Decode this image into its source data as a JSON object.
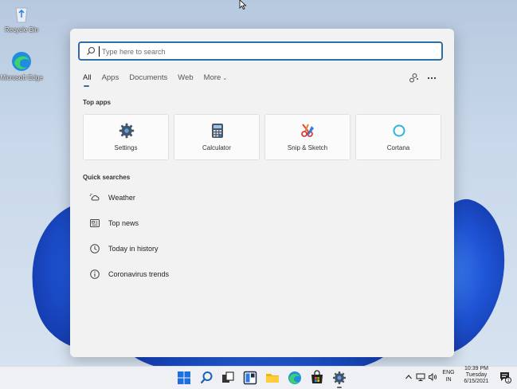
{
  "desktop": {
    "icons": [
      {
        "label": "Recycle Bin"
      },
      {
        "label": "Microsoft Edge"
      }
    ]
  },
  "search": {
    "placeholder": "Type here to search",
    "value": ""
  },
  "tabs": [
    {
      "label": "All",
      "active": true
    },
    {
      "label": "Apps"
    },
    {
      "label": "Documents"
    },
    {
      "label": "Web"
    },
    {
      "label": "More",
      "icon": "chevron-down-icon"
    }
  ],
  "top_apps": {
    "title": "Top apps",
    "items": [
      {
        "label": "Settings",
        "icon": "gear-icon"
      },
      {
        "label": "Calculator",
        "icon": "calculator-icon"
      },
      {
        "label": "Snip & Sketch",
        "icon": "scissors-icon"
      },
      {
        "label": "Cortana",
        "icon": "cortana-ring-icon"
      }
    ]
  },
  "quick_searches": {
    "title": "Quick searches",
    "items": [
      {
        "label": "Weather",
        "icon": "weather-icon"
      },
      {
        "label": "Top news",
        "icon": "news-icon"
      },
      {
        "label": "Today in history",
        "icon": "clock-icon"
      },
      {
        "label": "Coronavirus trends",
        "icon": "info-icon"
      }
    ]
  },
  "taskbar": {
    "language": "ENG",
    "region": "IN",
    "time": "10:39 PM",
    "day": "Tuesday",
    "date": "6/15/2021",
    "notification_count": "1"
  },
  "colors": {
    "accent": "#2f6da3",
    "panel": "#f2f2f2",
    "taskbar": "#eef0f3"
  }
}
